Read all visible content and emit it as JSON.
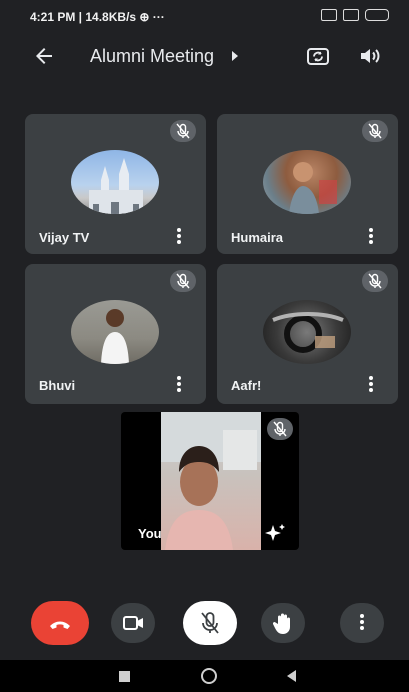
{
  "status_bar": {
    "text": "4:21 PM | 14.8KB/s ⊕  ···"
  },
  "header": {
    "title": "Alumni Meeting"
  },
  "participants": [
    {
      "name": "Vijay TV"
    },
    {
      "name": "Humaira"
    },
    {
      "name": "Bhuvi"
    },
    {
      "name": "Aafr!"
    }
  ],
  "self_view": {
    "label": "You"
  },
  "colors": {
    "background": "#202124",
    "tile": "#3c4043",
    "end_call": "#ea4335",
    "control": "#3c4043"
  },
  "icons": [
    "back-arrow-icon",
    "switch-camera-icon",
    "speaker-icon",
    "mic-off-icon",
    "more-vert-icon",
    "effects-sparkle-icon",
    "end-call-icon",
    "camera-icon",
    "raise-hand-icon"
  ]
}
